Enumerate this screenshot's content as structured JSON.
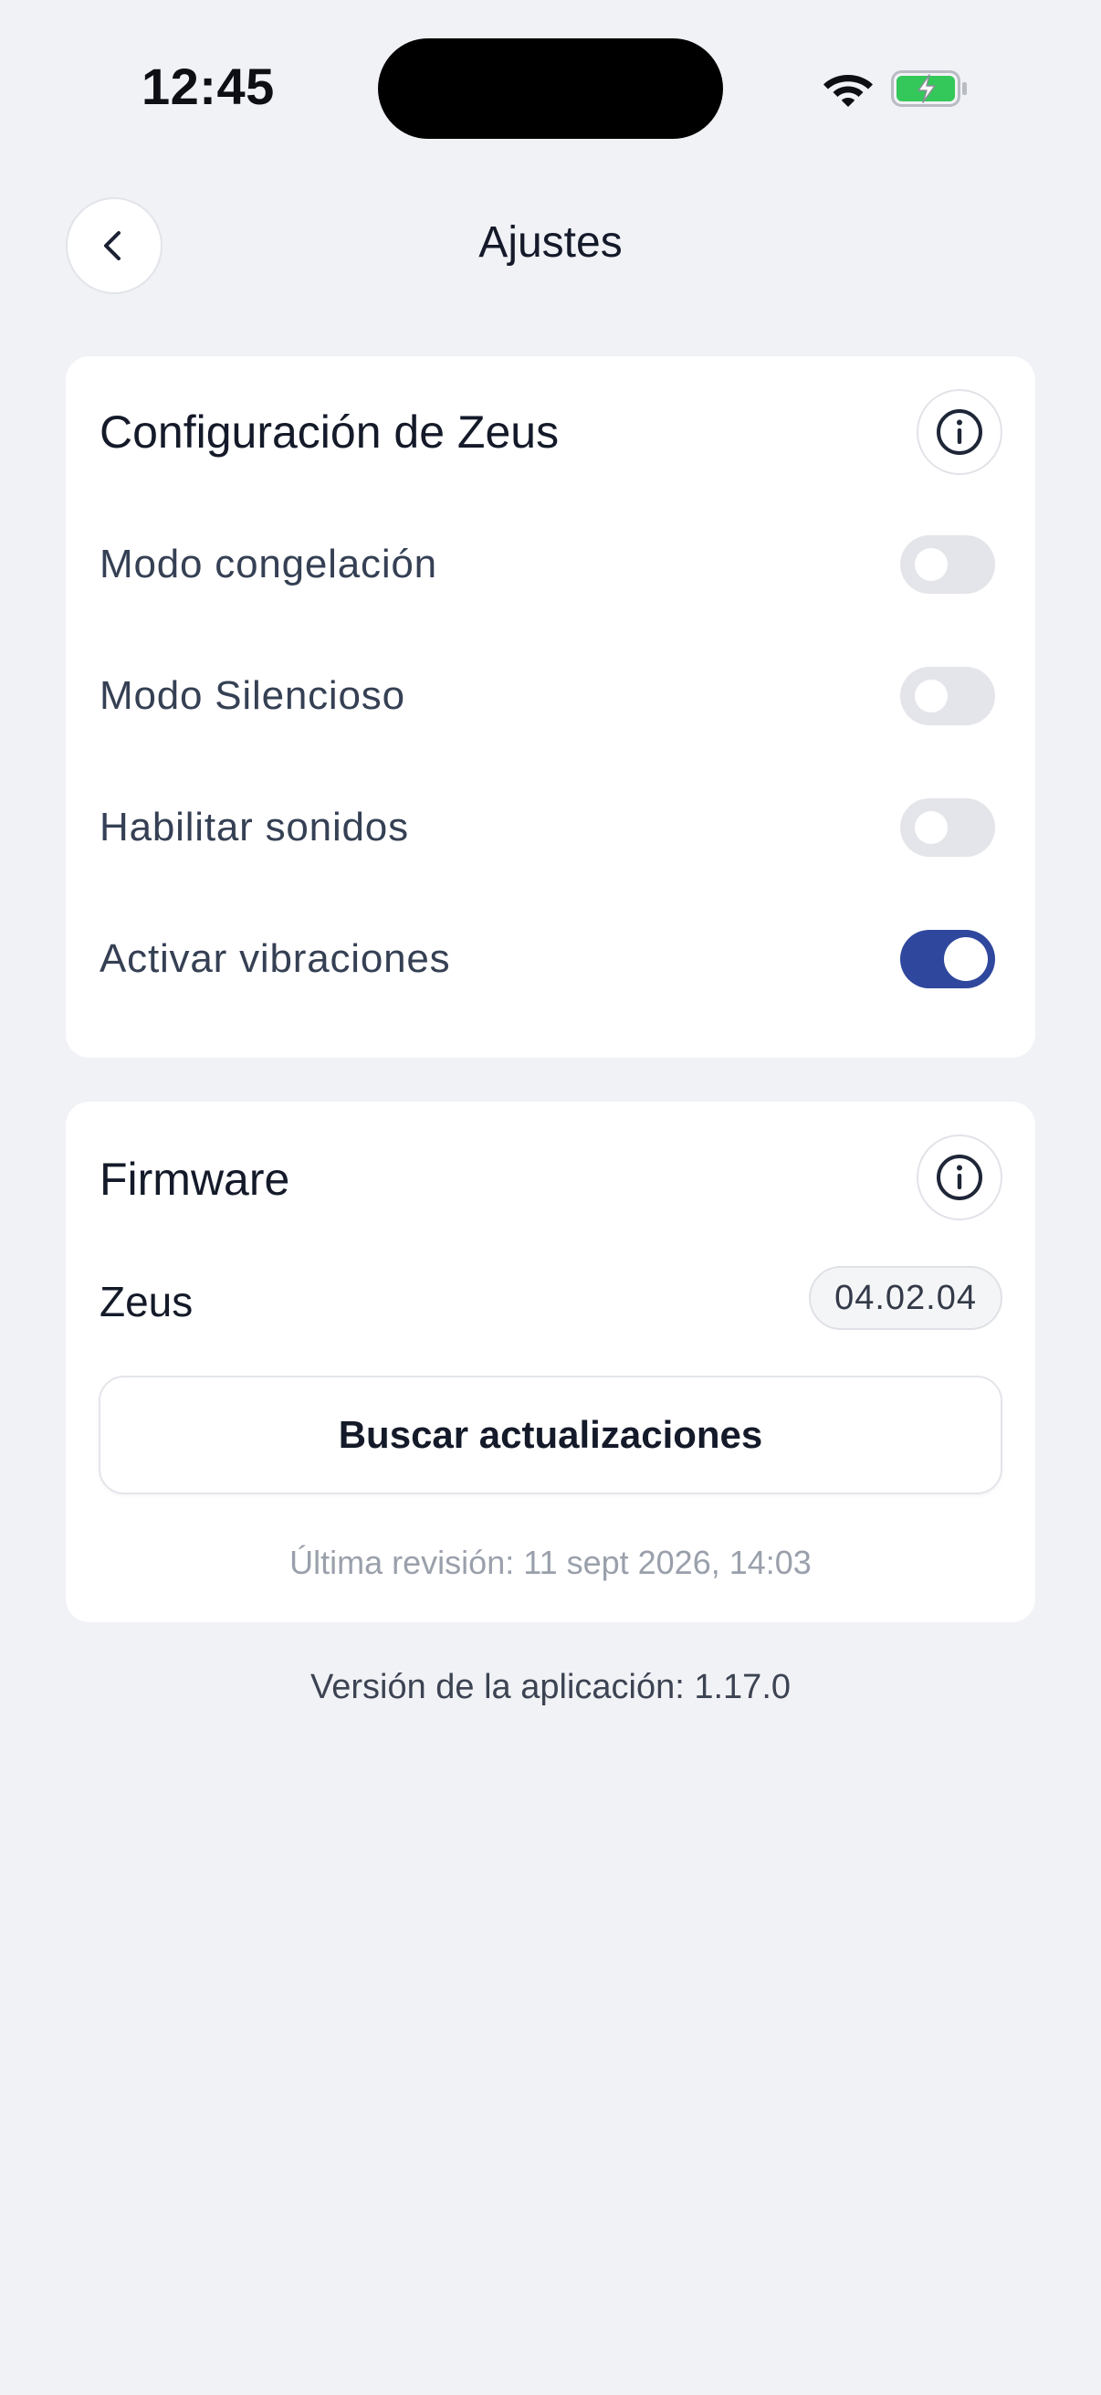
{
  "status_bar": {
    "time": "12:45",
    "wifi_icon": "wifi-icon",
    "battery_icon": "battery-charging-icon",
    "battery_color": "#34c759"
  },
  "header": {
    "back_icon": "chevron-left-icon",
    "title": "Ajustes"
  },
  "zeus_settings": {
    "title": "Configuración de Zeus",
    "info_icon": "info-icon",
    "items": [
      {
        "label": "Modo congelación",
        "enabled": false
      },
      {
        "label": "Modo Silencioso",
        "enabled": false
      },
      {
        "label": "Habilitar sonidos",
        "enabled": false
      },
      {
        "label": "Activar vibraciones",
        "enabled": true
      }
    ]
  },
  "firmware": {
    "title": "Firmware",
    "info_icon": "info-icon",
    "device_name": "Zeus",
    "version": "04.02.04",
    "update_button_label": "Buscar actualizaciones",
    "last_check": "Última revisión: 11 sept 2026, 14:03"
  },
  "footer": {
    "app_version": "Versión de la aplicación: 1.17.0"
  },
  "colors": {
    "background": "#f1f2f6",
    "accent": "#2f479d",
    "toggle_off": "#e4e5ea"
  }
}
